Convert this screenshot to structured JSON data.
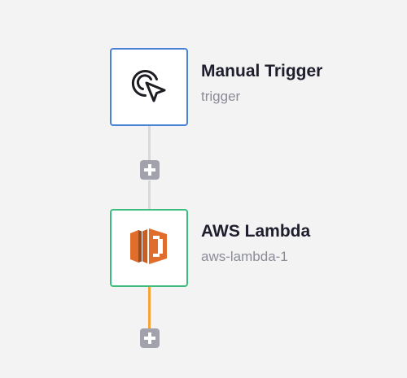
{
  "workflow": {
    "nodes": [
      {
        "title": "Manual Trigger",
        "subtitle": "trigger",
        "icon": "cursor-click-icon",
        "border_color": "#4a83d6"
      },
      {
        "title": "AWS Lambda",
        "subtitle": "aws-lambda-1",
        "icon": "aws-lambda-icon",
        "border_color": "#3dbd7d"
      }
    ],
    "add_buttons": [
      {
        "icon": "plus-icon"
      },
      {
        "icon": "plus-icon"
      }
    ],
    "colors": {
      "canvas_background": "#f3f3f4",
      "connector": "#d9d9dc",
      "active_connector": "#f8a338",
      "add_button": "#a2a2ad",
      "lambda_orange": "#e16d2c"
    }
  }
}
